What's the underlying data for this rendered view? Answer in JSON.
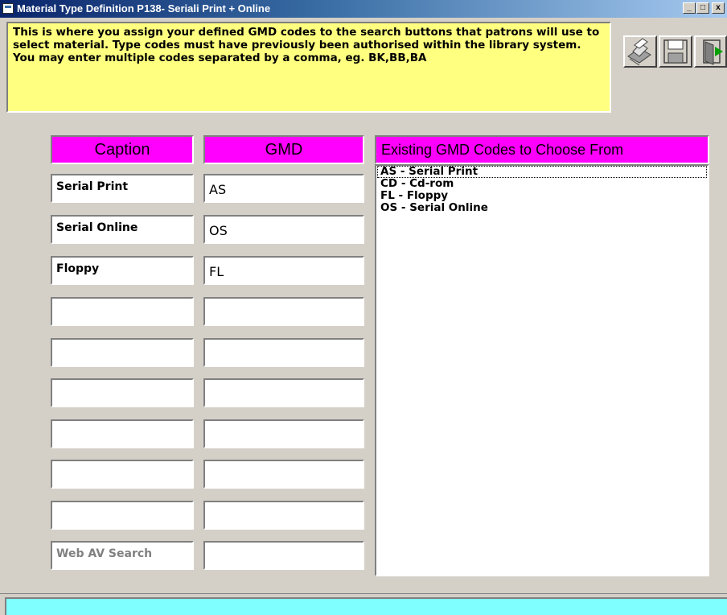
{
  "window": {
    "title": "Material Type Definition  P138- Seriali Print + Online",
    "minimize_label": "_",
    "maximize_label": "□",
    "close_label": "x"
  },
  "info_text": "This is where you assign your defined GMD codes to the search buttons that patrons will use to select material.  Type codes must have previously been authorised within the library system.  You may enter multiple codes separated by a comma,  eg. BK,BB,BA",
  "toolbar": {
    "icons": [
      "printer-icon",
      "save-disk-icon",
      "exit-door-icon"
    ]
  },
  "headers": {
    "caption": "Caption",
    "gmd": "GMD",
    "existing": "Existing GMD Codes to Choose From"
  },
  "rows": [
    {
      "caption": "Serial Print",
      "gmd": "AS"
    },
    {
      "caption": "Serial Online",
      "gmd": "OS"
    },
    {
      "caption": "Floppy",
      "gmd": "FL"
    },
    {
      "caption": "",
      "gmd": ""
    },
    {
      "caption": "",
      "gmd": ""
    },
    {
      "caption": "",
      "gmd": ""
    },
    {
      "caption": "",
      "gmd": ""
    },
    {
      "caption": "",
      "gmd": ""
    },
    {
      "caption": "",
      "gmd": ""
    },
    {
      "caption": "Web AV Search",
      "gmd": ""
    }
  ],
  "existing_codes": [
    "AS - Serial Print",
    "CD - Cd-rom",
    "FL - Floppy",
    "OS - Serial Online"
  ],
  "colors": {
    "info_background": "#ffff80",
    "header_background": "#ff00ff",
    "status_background": "#7fffff",
    "title_gradient_start": "#0a246a"
  }
}
